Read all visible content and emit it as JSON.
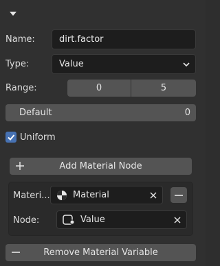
{
  "header": {
    "collapse_icon": "disclosure-triangle-down-icon"
  },
  "name": {
    "label": "Name:",
    "value": "dirt.factor"
  },
  "type": {
    "label": "Type:",
    "value": "Value",
    "dropdown_icon": "chevron-down-icon"
  },
  "range": {
    "label": "Range:",
    "min": "0",
    "max": "5"
  },
  "default": {
    "label": "Default",
    "value": "0"
  },
  "uniform": {
    "label": "Uniform",
    "checked": true
  },
  "add_node": {
    "label": "Add Material Node",
    "icon": "plus-icon"
  },
  "node_group": {
    "material_label": "Materi...",
    "material_value": "Material",
    "material_icon": "material-sphere-icon",
    "node_label": "Node:",
    "node_value": "Value",
    "node_icon": "node-icon"
  },
  "remove": {
    "label": "Remove Material Variable",
    "icon": "minus-icon"
  },
  "colors": {
    "background": "#303030",
    "field": "#1d1d1d",
    "button": "#545454",
    "accent": "#4772b3"
  }
}
